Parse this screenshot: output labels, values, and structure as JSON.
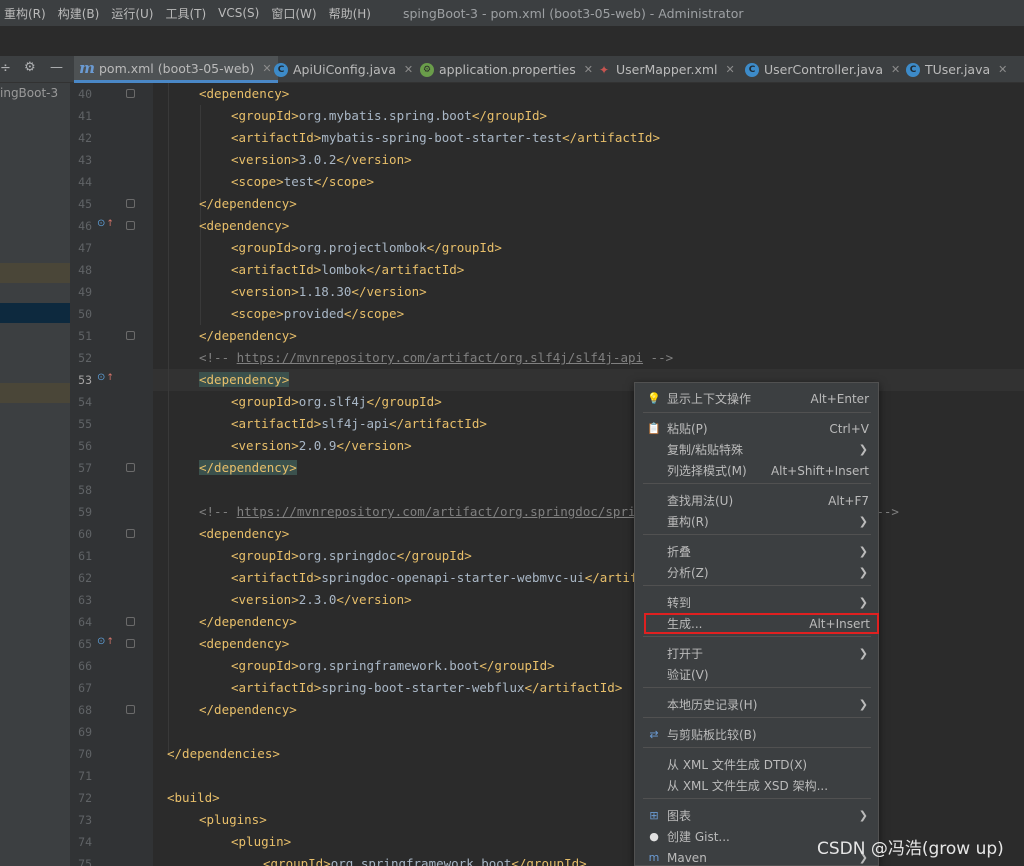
{
  "menubar": {
    "items": [
      "重构(R)",
      "构建(B)",
      "运行(U)",
      "工具(T)",
      "VCS(S)",
      "窗口(W)",
      "帮助(H)"
    ],
    "window_title": "spingBoot-3 - pom.xml (boot3-05-web) - Administrator"
  },
  "tabs": [
    {
      "label": "pom.xml (boot3-05-web)",
      "icon": "maven-icon",
      "active": true
    },
    {
      "label": "ApiUiConfig.java",
      "icon": "class-icon"
    },
    {
      "label": "application.properties",
      "icon": "spring-leaf-icon"
    },
    {
      "label": "UserMapper.xml",
      "icon": "mybatis-bird-icon"
    },
    {
      "label": "UserController.java",
      "icon": "class-icon"
    },
    {
      "label": "TUser.java",
      "icon": "class-icon"
    }
  ],
  "project": {
    "name": "ingBoot-3"
  },
  "lines": [
    {
      "n": "40",
      "parts": [
        {
          "c": "tag",
          "t": "<dependency>"
        }
      ],
      "indent": 1
    },
    {
      "n": "41",
      "parts": [
        {
          "c": "tag",
          "t": "<groupId>"
        },
        {
          "c": "txt",
          "t": "org.mybatis.spring.boot"
        },
        {
          "c": "tag",
          "t": "</groupId>"
        }
      ],
      "indent": 2
    },
    {
      "n": "42",
      "parts": [
        {
          "c": "tag",
          "t": "<artifactId>"
        },
        {
          "c": "txt",
          "t": "mybatis-spring-boot-starter-test"
        },
        {
          "c": "tag",
          "t": "</artifactId>"
        }
      ],
      "indent": 2
    },
    {
      "n": "43",
      "parts": [
        {
          "c": "tag",
          "t": "<version>"
        },
        {
          "c": "txt",
          "t": "3.0.2"
        },
        {
          "c": "tag",
          "t": "</version>"
        }
      ],
      "indent": 2
    },
    {
      "n": "44",
      "parts": [
        {
          "c": "tag",
          "t": "<scope>"
        },
        {
          "c": "txt",
          "t": "test"
        },
        {
          "c": "tag",
          "t": "</scope>"
        }
      ],
      "indent": 2
    },
    {
      "n": "45",
      "parts": [
        {
          "c": "tag",
          "t": "</dependency>"
        }
      ],
      "indent": 1
    },
    {
      "n": "46",
      "parts": [
        {
          "c": "tag",
          "t": "<dependency>"
        }
      ],
      "indent": 1
    },
    {
      "n": "47",
      "parts": [
        {
          "c": "tag",
          "t": "<groupId>"
        },
        {
          "c": "txt",
          "t": "org.projectlombok"
        },
        {
          "c": "tag",
          "t": "</groupId>"
        }
      ],
      "indent": 2
    },
    {
      "n": "48",
      "parts": [
        {
          "c": "tag",
          "t": "<artifactId>"
        },
        {
          "c": "txt",
          "t": "lombok"
        },
        {
          "c": "tag",
          "t": "</artifactId>"
        }
      ],
      "indent": 2
    },
    {
      "n": "49",
      "parts": [
        {
          "c": "tag",
          "t": "<version>"
        },
        {
          "c": "txt",
          "t": "1.18.30"
        },
        {
          "c": "tag",
          "t": "</version>"
        }
      ],
      "indent": 2
    },
    {
      "n": "50",
      "parts": [
        {
          "c": "tag",
          "t": "<scope>"
        },
        {
          "c": "txt",
          "t": "provided"
        },
        {
          "c": "tag",
          "t": "</scope>"
        }
      ],
      "indent": 2
    },
    {
      "n": "51",
      "parts": [
        {
          "c": "tag",
          "t": "</dependency>"
        }
      ],
      "indent": 1
    },
    {
      "n": "52",
      "parts": [
        {
          "c": "cmt",
          "t": "<!-- "
        },
        {
          "c": "cmt-link",
          "t": "https://mvnrepository.com/artifact/org.slf4j/slf4j-api"
        },
        {
          "c": "cmt",
          "t": " -->"
        }
      ],
      "indent": 1
    },
    {
      "n": "53",
      "parts": [
        {
          "c": "tag hl",
          "t": "<dependency>"
        }
      ],
      "indent": 1
    },
    {
      "n": "54",
      "parts": [
        {
          "c": "tag",
          "t": "<groupId>"
        },
        {
          "c": "txt",
          "t": "org.slf4j"
        },
        {
          "c": "tag",
          "t": "</groupId>"
        }
      ],
      "indent": 2
    },
    {
      "n": "55",
      "parts": [
        {
          "c": "tag",
          "t": "<artifactId>"
        },
        {
          "c": "txt",
          "t": "slf4j-api"
        },
        {
          "c": "tag",
          "t": "</artifactId>"
        }
      ],
      "indent": 2
    },
    {
      "n": "56",
      "parts": [
        {
          "c": "tag",
          "t": "<version>"
        },
        {
          "c": "txt",
          "t": "2.0.9"
        },
        {
          "c": "tag",
          "t": "</version>"
        }
      ],
      "indent": 2
    },
    {
      "n": "57",
      "parts": [
        {
          "c": "tag hl",
          "t": "</dependency>"
        }
      ],
      "indent": 1
    },
    {
      "n": "58",
      "parts": [],
      "indent": 0
    },
    {
      "n": "59",
      "parts": [
        {
          "c": "cmt",
          "t": "<!-- "
        },
        {
          "c": "cmt-link",
          "t": "https://mvnrepository.com/artifact/org.springdoc/springdoc-openapi-starter-webmvc-ui"
        },
        {
          "c": "cmt",
          "t": " -->"
        }
      ],
      "indent": 1
    },
    {
      "n": "60",
      "parts": [
        {
          "c": "tag",
          "t": "<dependency>"
        }
      ],
      "indent": 1
    },
    {
      "n": "61",
      "parts": [
        {
          "c": "tag",
          "t": "<groupId>"
        },
        {
          "c": "txt",
          "t": "org.springdoc"
        },
        {
          "c": "tag",
          "t": "</groupId>"
        }
      ],
      "indent": 2
    },
    {
      "n": "62",
      "parts": [
        {
          "c": "tag",
          "t": "<artifactId>"
        },
        {
          "c": "txt",
          "t": "springdoc-openapi-starter-webmvc-ui"
        },
        {
          "c": "tag",
          "t": "</artifactId>"
        }
      ],
      "indent": 2
    },
    {
      "n": "63",
      "parts": [
        {
          "c": "tag",
          "t": "<version>"
        },
        {
          "c": "txt",
          "t": "2.3.0"
        },
        {
          "c": "tag",
          "t": "</version>"
        }
      ],
      "indent": 2
    },
    {
      "n": "64",
      "parts": [
        {
          "c": "tag",
          "t": "</dependency>"
        }
      ],
      "indent": 1
    },
    {
      "n": "65",
      "parts": [
        {
          "c": "tag",
          "t": "<dependency>"
        }
      ],
      "indent": 1
    },
    {
      "n": "66",
      "parts": [
        {
          "c": "tag",
          "t": "<groupId>"
        },
        {
          "c": "txt",
          "t": "org.springframework.boot"
        },
        {
          "c": "tag",
          "t": "</groupId>"
        }
      ],
      "indent": 2
    },
    {
      "n": "67",
      "parts": [
        {
          "c": "tag",
          "t": "<artifactId>"
        },
        {
          "c": "txt",
          "t": "spring-boot-starter-webflux"
        },
        {
          "c": "tag",
          "t": "</artifactId>"
        }
      ],
      "indent": 2
    },
    {
      "n": "68",
      "parts": [
        {
          "c": "tag",
          "t": "</dependency>"
        }
      ],
      "indent": 1
    },
    {
      "n": "69",
      "parts": [],
      "indent": 0
    },
    {
      "n": "70",
      "parts": [
        {
          "c": "tag",
          "t": "</dependencies>"
        }
      ],
      "indent": 0
    },
    {
      "n": "71",
      "parts": [],
      "indent": 0
    },
    {
      "n": "72",
      "parts": [
        {
          "c": "tag",
          "t": "<build>"
        }
      ],
      "indent": 0
    },
    {
      "n": "73",
      "parts": [
        {
          "c": "tag",
          "t": "<plugins>"
        }
      ],
      "indent": 1
    },
    {
      "n": "74",
      "parts": [
        {
          "c": "tag",
          "t": "<plugin>"
        }
      ],
      "indent": 2
    },
    {
      "n": "75",
      "parts": [
        {
          "c": "tag",
          "t": "<groupId>"
        },
        {
          "c": "txt",
          "t": "org.springframework.boot"
        },
        {
          "c": "tag",
          "t": "</groupId>"
        }
      ],
      "indent": 3
    }
  ],
  "context_menu": {
    "items": [
      {
        "label": "显示上下文操作",
        "shortcut": "Alt+Enter",
        "icon": "bulb-icon"
      },
      {
        "label": "粘贴(P)",
        "shortcut": "Ctrl+V",
        "icon": "clipboard-icon"
      },
      {
        "label": "复制/粘贴特殊",
        "submenu": true
      },
      {
        "label": "列选择模式(M)",
        "shortcut": "Alt+Shift+Insert"
      },
      {
        "label": "查找用法(U)",
        "shortcut": "Alt+F7"
      },
      {
        "label": "重构(R)",
        "submenu": true
      },
      {
        "label": "折叠",
        "submenu": true
      },
      {
        "label": "分析(Z)",
        "submenu": true
      },
      {
        "label": "转到",
        "submenu": true
      },
      {
        "label": "生成...",
        "shortcut": "Alt+Insert",
        "selected": true
      },
      {
        "label": "打开于",
        "submenu": true
      },
      {
        "label": "验证(V)"
      },
      {
        "label": "本地历史记录(H)",
        "submenu": true
      },
      {
        "label": "与剪贴板比较(B)",
        "icon": "compare-icon"
      },
      {
        "label": "从 XML 文件生成 DTD(X)"
      },
      {
        "label": "从 XML 文件生成 XSD 架构..."
      },
      {
        "label": "图表",
        "submenu": true,
        "icon": "diagram-icon"
      },
      {
        "label": "创建 Gist...",
        "icon": "github-icon"
      },
      {
        "label": "Maven",
        "submenu": true,
        "icon": "maven-icon"
      }
    ]
  },
  "watermark": "CSDN @冯浩(grow up)"
}
